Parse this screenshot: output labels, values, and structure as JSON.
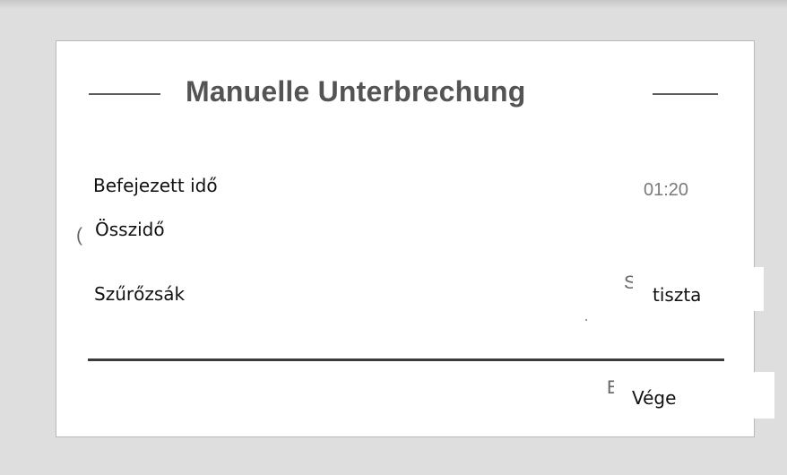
{
  "dialog": {
    "title": "Manuelle Unterbrechung",
    "rows": {
      "finished_time": {
        "label": "Befejezett idő",
        "value": "01:20"
      },
      "total_time": {
        "label": "Összidő"
      },
      "filter_bag": {
        "label": "Szűrőzsák",
        "status": "tiszta"
      }
    },
    "end_button": {
      "label": "Vége"
    }
  },
  "colors": {
    "background": "#dedede",
    "panel": "#ffffff",
    "title": "#545454",
    "value_text": "#7a7a7a",
    "divider": "#3b3b3b"
  }
}
